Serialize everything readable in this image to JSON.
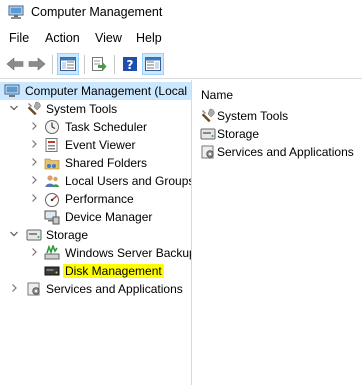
{
  "window": {
    "title": "Computer Management",
    "icon": "computer-management-icon"
  },
  "menu": [
    "File",
    "Action",
    "View",
    "Help"
  ],
  "toolbar": {
    "buttons": [
      "back-arrow-icon",
      "forward-arrow-icon",
      "show-hide-console-tree-icon",
      "export-list-icon",
      "help-icon",
      "action-pane-icon"
    ]
  },
  "tree": {
    "root": "Computer Management (Local",
    "system_tools": "System Tools",
    "task_scheduler": "Task Scheduler",
    "event_viewer": "Event Viewer",
    "shared_folders": "Shared Folders",
    "local_users": "Local Users and Groups",
    "performance": "Performance",
    "device_manager": "Device Manager",
    "storage": "Storage",
    "wsb": "Windows Server Backup",
    "disk_management": "Disk Management",
    "services": "Services and Applications"
  },
  "list": {
    "header": "Name",
    "items": [
      "System Tools",
      "Storage",
      "Services and Applications"
    ]
  },
  "colors": {
    "selection": "#cce8ff",
    "highlight": "#ffff00",
    "accent": "#1a5fb4"
  }
}
